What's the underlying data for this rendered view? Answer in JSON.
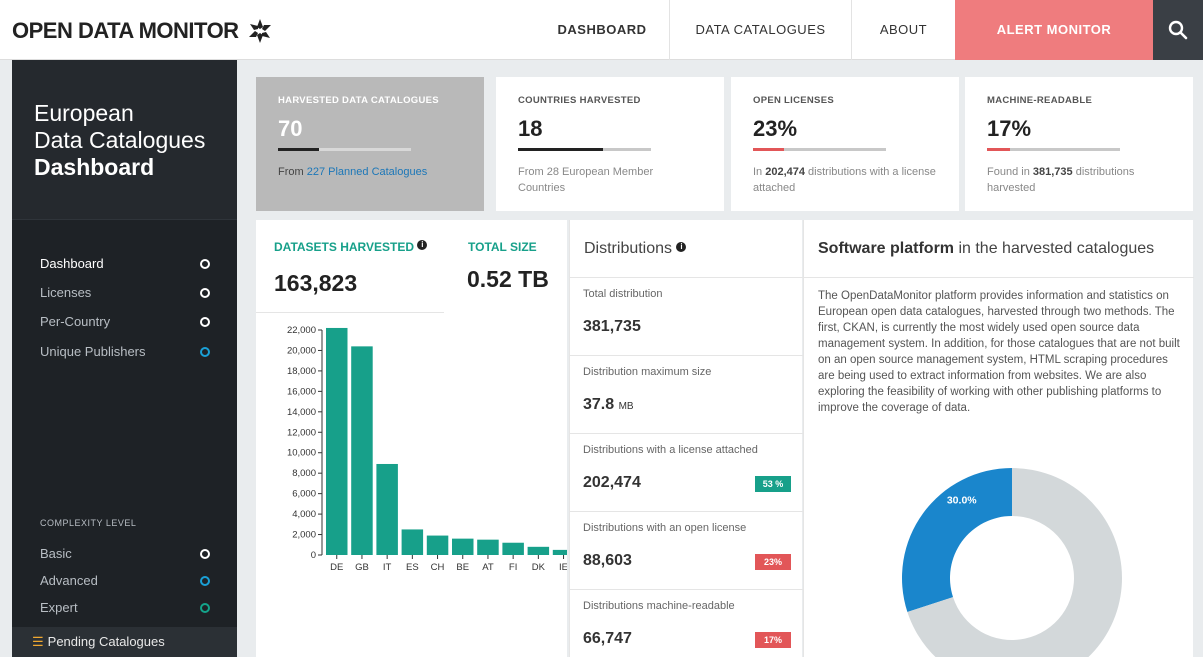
{
  "nav": {
    "logo": "OPEN DATA MONITOR",
    "dashboard": "DASHBOARD",
    "catalogues": "DATA CATALOGUES",
    "about": "ABOUT",
    "alert": "ALERT MONITOR"
  },
  "sidebar": {
    "title_line1": "European",
    "title_line2": "Data Catalogues",
    "title_line3": "Dashboard",
    "items": [
      {
        "label": "Dashboard"
      },
      {
        "label": "Licenses"
      },
      {
        "label": "Per-Country"
      },
      {
        "label": "Unique Publishers"
      }
    ],
    "complexity_caption": "COMPLEXITY LEVEL",
    "levels": [
      {
        "label": "Basic"
      },
      {
        "label": "Advanced"
      },
      {
        "label": "Expert"
      }
    ],
    "pending": "Pending Catalogues"
  },
  "cards": [
    {
      "label": "HARVESTED DATA CATALOGUES",
      "value": "70",
      "progress": 0.31,
      "note_prefix": "From ",
      "note_link": "227 Planned Catalogues"
    },
    {
      "label": "COUNTRIES HARVESTED",
      "value": "18",
      "progress": 0.64,
      "note": "From 28 European Member Countries"
    },
    {
      "label": "OPEN LICENSES",
      "value": "23%",
      "progress": 0.23,
      "note_prefix": "In ",
      "note_bold": "202,474",
      "note_suffix": " distributions with a license attached"
    },
    {
      "label": "MACHINE-READABLE",
      "value": "17%",
      "progress": 0.17,
      "note_prefix": "Found in ",
      "note_bold": "381,735",
      "note_suffix": " distributions harvested"
    }
  ],
  "datasets": {
    "label": "DATASETS HARVESTED",
    "value": "163,823",
    "size_label": "TOTAL SIZE",
    "size_value": "0.52 TB"
  },
  "distributions": {
    "title": "Distributions",
    "rows": [
      {
        "label": "Total distribution",
        "value": "381,735"
      },
      {
        "label": "Distribution maximum size",
        "value": "37.8",
        "unit": "MB"
      },
      {
        "label": "Distributions with a license attached",
        "value": "202,474",
        "badge": "53 %"
      },
      {
        "label": "Distributions with an open license",
        "value": "88,603",
        "badge": "23%"
      },
      {
        "label": "Distributions machine-readable",
        "value": "66,747",
        "badge": "17%"
      }
    ]
  },
  "software": {
    "title_bold": "Software platform",
    "title_rest": " in the harvested catalogues",
    "text": "The OpenDataMonitor platform provides information and statistics on European open data catalogues, harvested through two methods. The first, CKAN, is currently the most widely used open source data management system. In addition, for those catalogues that are not built on an open source management system, HTML scraping procedures are being used to extract information from websites. We are also exploring the feasibility of working with other publishing platforms to improve the coverage of data."
  },
  "colors": {
    "teal": "#17a08a",
    "red": "#e25658",
    "blue": "#1a86cc",
    "grey": "#d3d8da",
    "alert": "#ef7c7e"
  },
  "chart_data": [
    {
      "type": "bar",
      "categories": [
        "DE",
        "GB",
        "IT",
        "ES",
        "CH",
        "BE",
        "AT",
        "FI",
        "DK",
        "IE"
      ],
      "values": [
        22200,
        20400,
        8900,
        2500,
        1900,
        1600,
        1500,
        1200,
        800,
        500
      ],
      "ylim": [
        0,
        22000
      ],
      "yticks": [
        "0",
        "2,000",
        "4,000",
        "6,000",
        "8,000",
        "10,000",
        "12,000",
        "14,000",
        "16,000",
        "18,000",
        "20,000",
        "22,000"
      ],
      "color": "#17a08a"
    },
    {
      "type": "pie",
      "labels": [
        "30.0%",
        "70.0%"
      ],
      "values": [
        30.0,
        70.0
      ],
      "colors": [
        "#1a86cc",
        "#d3d8da"
      ]
    }
  ]
}
